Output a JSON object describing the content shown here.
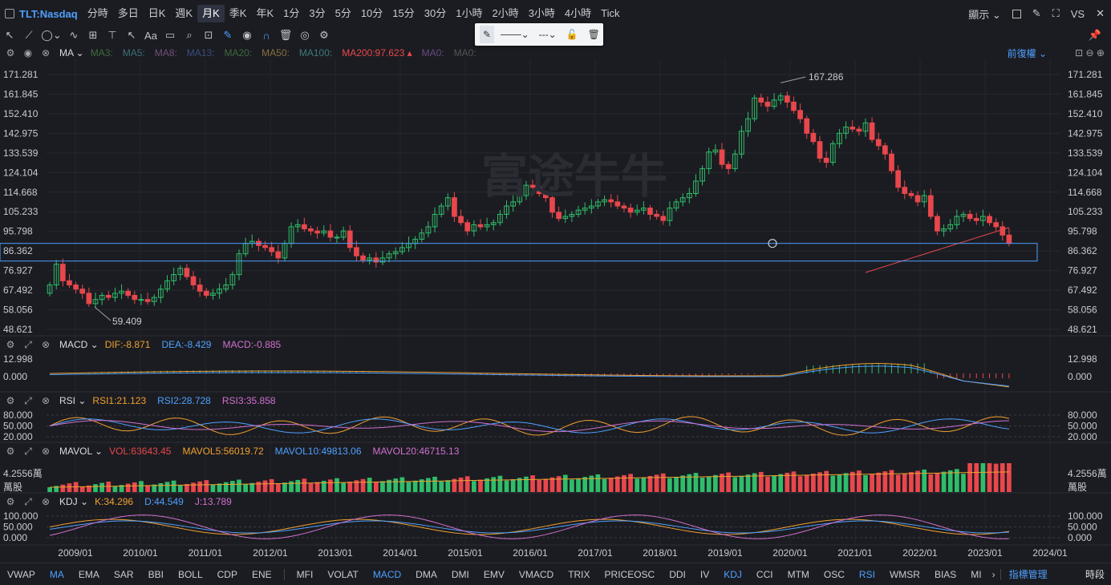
{
  "symbol": "TLT:Nasdaq",
  "timeframes": [
    "分時",
    "多日",
    "日K",
    "週K",
    "月K",
    "季K",
    "年K",
    "1分",
    "3分",
    "5分",
    "10分",
    "15分",
    "30分",
    "1小時",
    "2小時",
    "3小時",
    "4小時",
    "Tick"
  ],
  "active_timeframe": "月K",
  "top_right": {
    "display_label": "顯示",
    "vs_label": "VS"
  },
  "main_header": {
    "name": "MA",
    "values": [
      {
        "text": "MA3:",
        "color": "#3f6b3f"
      },
      {
        "text": "MA5:",
        "color": "#3e6e7a"
      },
      {
        "text": "MA8:",
        "color": "#704e7a"
      },
      {
        "text": "MA13:",
        "color": "#3a4e80"
      },
      {
        "text": "MA20:",
        "color": "#3e6b3e"
      },
      {
        "text": "MA50:",
        "color": "#8a7040"
      },
      {
        "text": "MA100:",
        "color": "#3e7a7a"
      },
      {
        "text": "MA200:97.623",
        "color": "#e8474c"
      },
      {
        "text": "MA0:",
        "color": "#6a4a80"
      },
      {
        "text": "MA0:",
        "color": "#555"
      }
    ],
    "adjust_label": "前復權"
  },
  "price_axis": [
    "171.281",
    "161.845",
    "152.410",
    "142.975",
    "133.539",
    "124.104",
    "114.668",
    "105.233",
    "95.798",
    "86.362",
    "76.927",
    "67.492",
    "58.056",
    "48.621"
  ],
  "annotations": {
    "high": "167.286",
    "low": "59.409"
  },
  "watermark": "富途牛牛",
  "macd": {
    "name": "MACD",
    "dif": "DIF:-8.871",
    "dea": "DEA:-8.429",
    "macd": "MACD:-0.885",
    "axis": [
      "12.998",
      "0.000"
    ]
  },
  "rsi": {
    "name": "RSI",
    "rsi1": "RSI1:21.123",
    "rsi2": "RSI2:28.728",
    "rsi3": "RSI3:35.858",
    "axis": [
      "80.000",
      "50.000",
      "20.000"
    ]
  },
  "mavol": {
    "name": "MAVOL",
    "vol": "VOL:63643.45",
    "mavol5": "MAVOL5:56019.72",
    "mavol10": "MAVOL10:49813.06",
    "mavol20": "MAVOL20:46715.13",
    "axis_value": "4.2556萬",
    "axis_unit": "萬股"
  },
  "kdj": {
    "name": "KDJ",
    "k": "K:34.296",
    "d": "D:44.549",
    "j": "J:13.789",
    "axis": [
      "100.000",
      "50.000",
      "0.000"
    ]
  },
  "time_axis": [
    "2009/01",
    "2010/01",
    "2011/01",
    "2012/01",
    "2013/01",
    "2014/01",
    "2015/01",
    "2016/01",
    "2017/01",
    "2018/01",
    "2019/01",
    "2020/01",
    "2021/01",
    "2022/01",
    "2023/01",
    "2024/01"
  ],
  "bottom_indicators_main": [
    "VWAP",
    "MA",
    "EMA",
    "SAR",
    "BBI",
    "BOLL",
    "CDP",
    "ENE"
  ],
  "bottom_indicators_sub": [
    "MFI",
    "VOLAT",
    "MACD",
    "DMA",
    "DMI",
    "EMV",
    "VMACD",
    "TRIX",
    "PRICEOSC",
    "DDI",
    "IV",
    "KDJ",
    "CCI",
    "MTM",
    "OSC",
    "RSI",
    "WMSR",
    "BIAS",
    "MI"
  ],
  "active_bottom": [
    "MA",
    "MACD",
    "KDJ",
    "RSI"
  ],
  "bottom_right": {
    "manage": "指標管理",
    "session": "時段"
  },
  "colors": {
    "up": "#2fbd6a",
    "down": "#e8474c",
    "accent": "#4ea0ff",
    "background": "#1b1c21"
  },
  "chart_data": {
    "type": "candlestick",
    "frequency": "monthly",
    "start": "2008/08",
    "ylim": [
      48.621,
      171.281
    ],
    "closes": [
      70,
      80,
      72,
      70,
      68,
      66,
      61,
      63,
      65,
      64,
      66,
      67,
      65,
      63,
      63,
      62,
      64,
      68,
      72,
      75,
      78,
      74,
      70,
      67,
      65,
      66,
      68,
      70,
      75,
      85,
      90,
      91,
      89,
      88,
      86,
      83,
      90,
      98,
      99,
      97,
      96,
      95,
      96,
      93,
      93,
      96,
      88,
      84,
      82,
      83,
      81,
      83,
      85,
      86,
      88,
      90,
      92,
      95,
      98,
      104,
      108,
      112,
      103,
      100,
      96,
      99,
      98,
      99,
      100,
      104,
      108,
      110,
      113,
      118,
      117,
      114,
      112,
      105,
      102,
      103,
      104,
      106,
      107,
      108,
      110,
      111,
      110,
      108,
      107,
      105,
      106,
      107,
      104,
      103,
      101,
      107,
      110,
      112,
      114,
      120,
      126,
      134,
      135,
      128,
      126,
      133,
      144,
      150,
      160,
      158,
      156,
      159,
      161,
      158,
      154,
      150,
      143,
      139,
      131,
      129,
      138,
      143,
      146,
      145,
      144,
      148,
      140,
      137,
      133,
      125,
      117,
      114,
      113,
      110,
      113,
      103,
      96,
      97,
      99,
      103,
      104,
      102,
      101,
      103,
      100,
      98,
      94,
      90
    ],
    "ma200_from": "2019/01",
    "ma200_last": 97.623,
    "support_zone": [
      81.5,
      90.0
    ]
  }
}
